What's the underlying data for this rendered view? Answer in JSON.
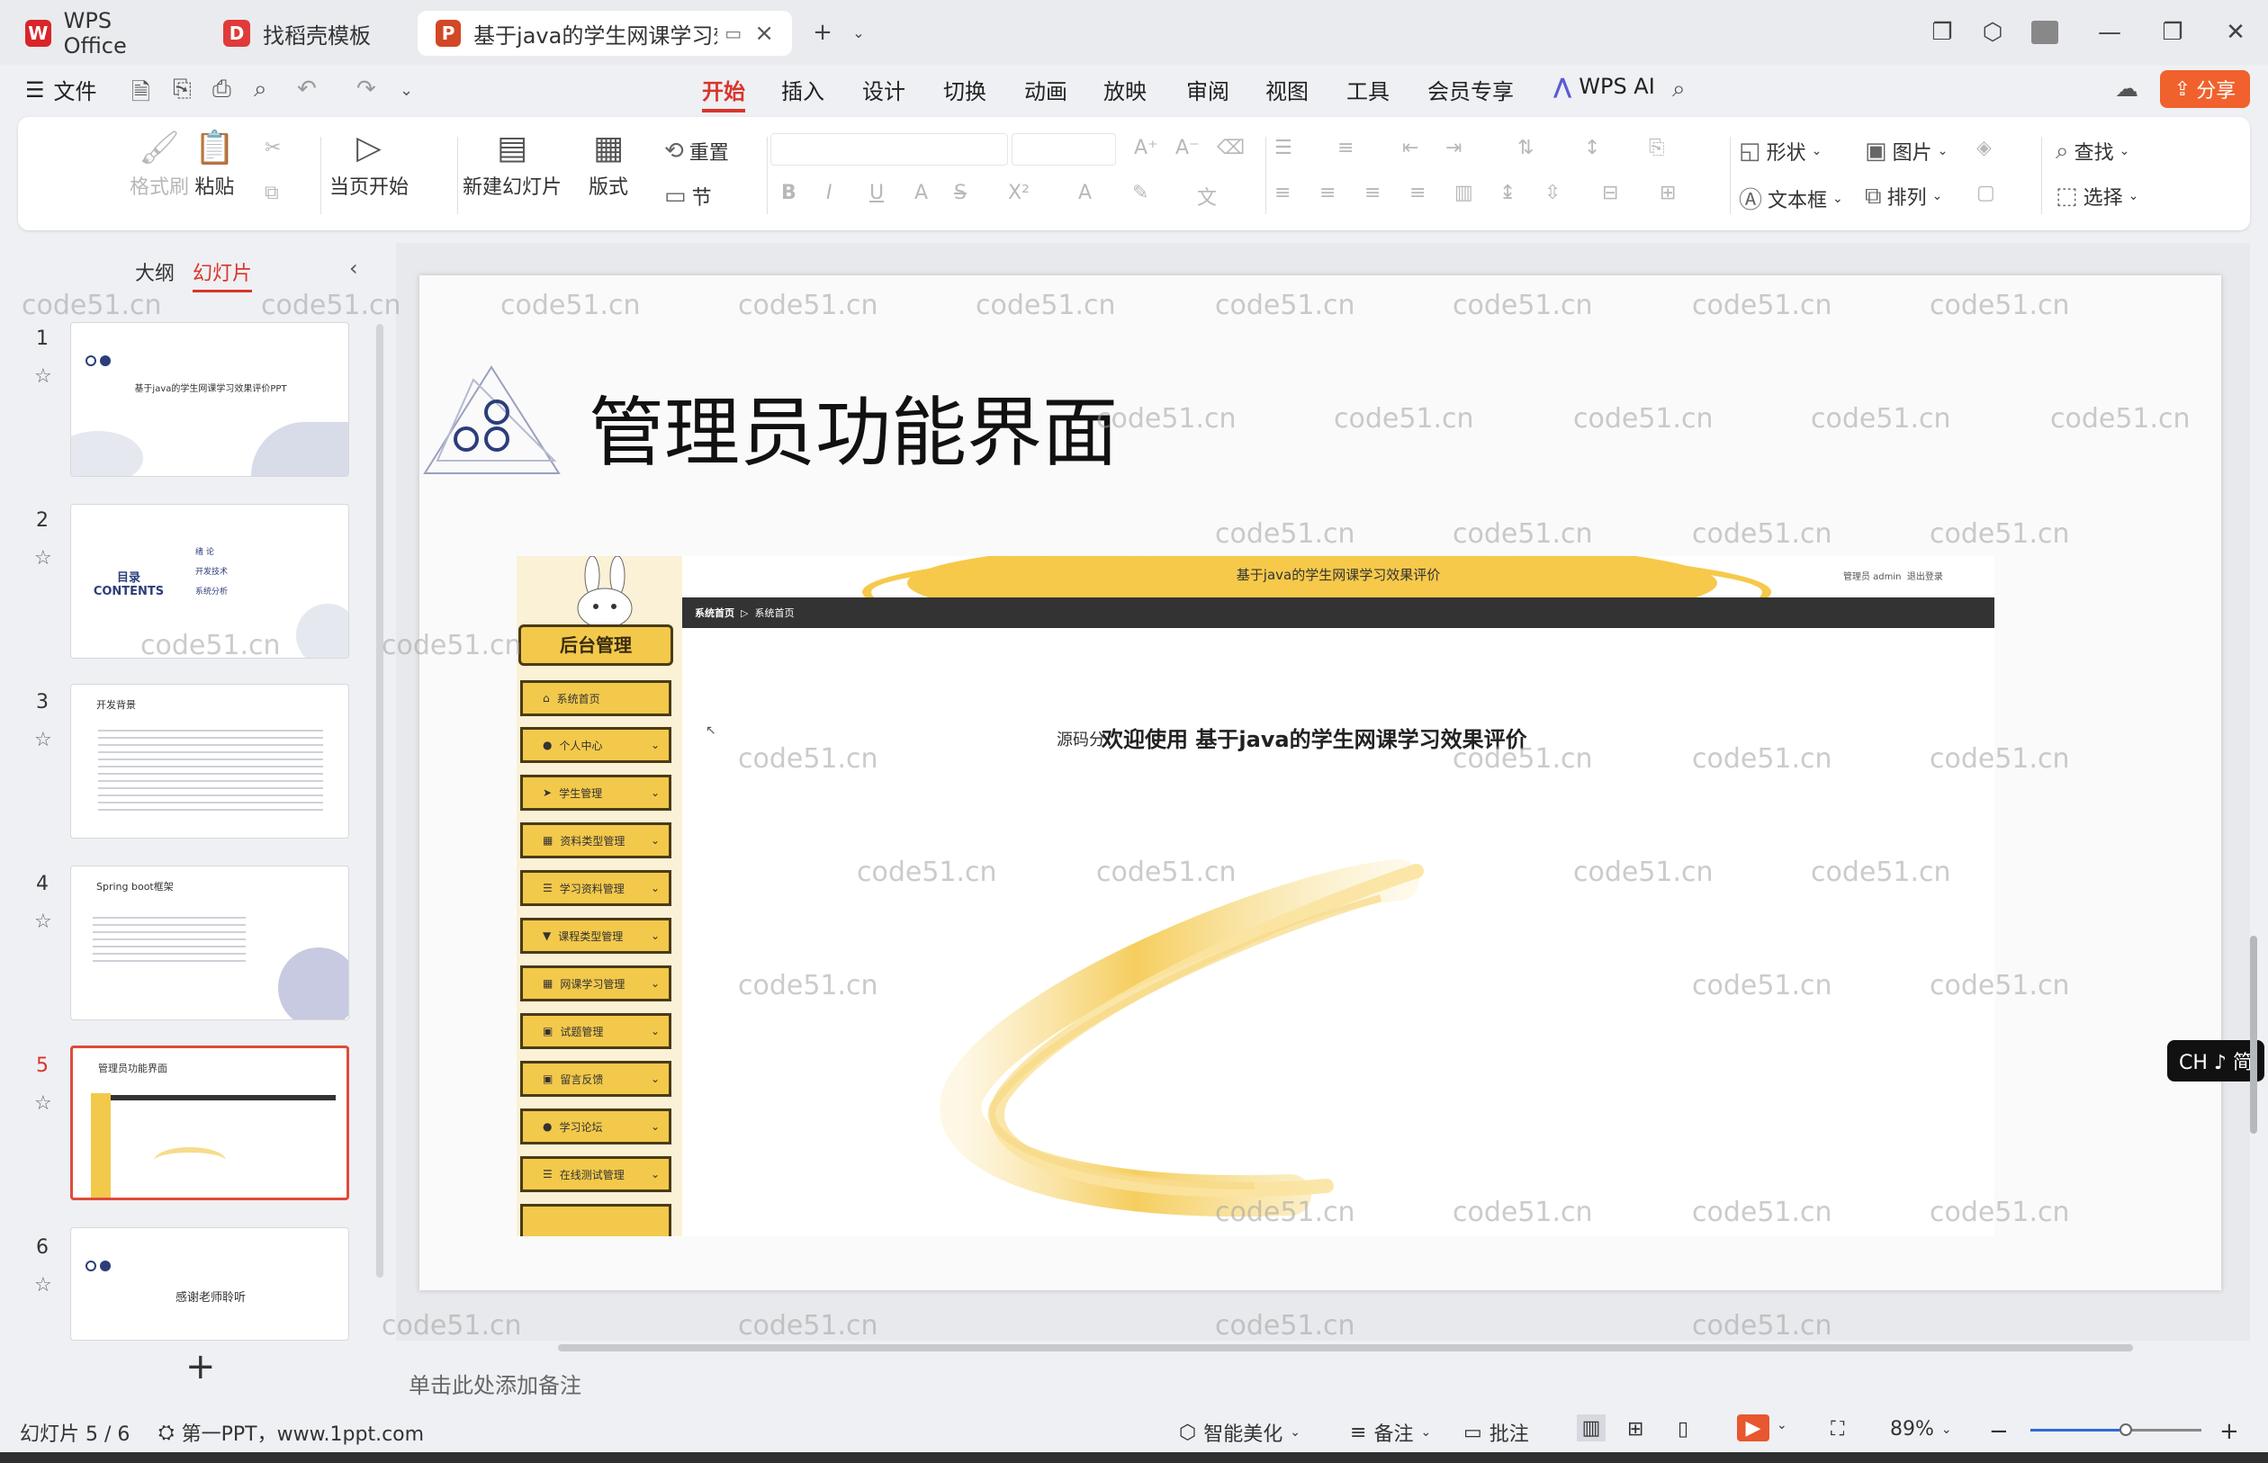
{
  "titlebar": {
    "tabs": [
      {
        "label": "WPS Office",
        "logo": "W",
        "color": "#d9252a"
      },
      {
        "label": "找稻壳模板",
        "logo": "D",
        "color": "#e03a3a"
      },
      {
        "label": "基于java的学生网课学习效果评价",
        "logo": "P",
        "color": "#d24726"
      }
    ],
    "new_tab_symbol": "+"
  },
  "menubar": {
    "file_label": "文件",
    "tabs": [
      "开始",
      "插入",
      "设计",
      "切换",
      "动画",
      "放映",
      "审阅",
      "视图",
      "工具",
      "会员专享"
    ],
    "active_tab": "开始",
    "wps_ai_label": "WPS AI",
    "share_label": "分享"
  },
  "ribbon": {
    "format_painter": "格式刷",
    "paste": "粘贴",
    "play_from_current": "当页开始",
    "new_slide": "新建幻灯片",
    "layout": "版式",
    "reset": "重置",
    "section": "节",
    "shape": "形状",
    "picture": "图片",
    "find": "查找",
    "textbox": "文本框",
    "arrange": "排列",
    "select": "选择"
  },
  "leftpanel": {
    "tab_outline": "大纲",
    "tab_slides": "幻灯片",
    "active_tab": "幻灯片",
    "slides": [
      {
        "num": "1",
        "title": "基于java的学生网课学习效果评价PPT"
      },
      {
        "num": "2",
        "title": "目录 CONTENTS"
      },
      {
        "num": "3",
        "title": "开发背景"
      },
      {
        "num": "4",
        "title": "Spring boot框架"
      },
      {
        "num": "5",
        "title": "管理员功能界面"
      },
      {
        "num": "6",
        "title": "感谢老师聆听"
      }
    ],
    "toc_items": [
      "绪 论",
      "开发技术",
      "系统分析"
    ],
    "selected_slide": "5",
    "add_symbol": "+"
  },
  "slide": {
    "title": "管理员功能界面",
    "shot": {
      "header_title": "基于java的学生网课学习效果评价",
      "header_user": "管理员 admin",
      "header_logout": "退出登录",
      "breadcrumb_home": "系统首页",
      "breadcrumb_current": "系统首页",
      "sidebar_title": "后台管理",
      "menu": [
        "系统首页",
        "个人中心",
        "学生管理",
        "资料类型管理",
        "学习资料管理",
        "课程类型管理",
        "网课学习管理",
        "试题管理",
        "留言反馈",
        "学习论坛",
        "在线测试管理"
      ],
      "welcome": "欢迎使用 基于java的学生网课学习效果评价",
      "welcome_overlay": "源码分"
    }
  },
  "watermark": "code51.cn",
  "ime": "CH ♪ 简",
  "notes_placeholder": "单击此处添加备注",
  "status": {
    "slide_counter": "幻灯片 5 / 6",
    "theme": "第一PPT，www.1ppt.com",
    "beautify": "智能美化",
    "notes": "备注",
    "comments": "批注",
    "zoom": "89%",
    "zoom_level": 0.56
  },
  "colors": {
    "accent": "#d9352c",
    "yellow": "#f3c94b",
    "dark_bar": "#333333",
    "share": "#f0612d"
  }
}
